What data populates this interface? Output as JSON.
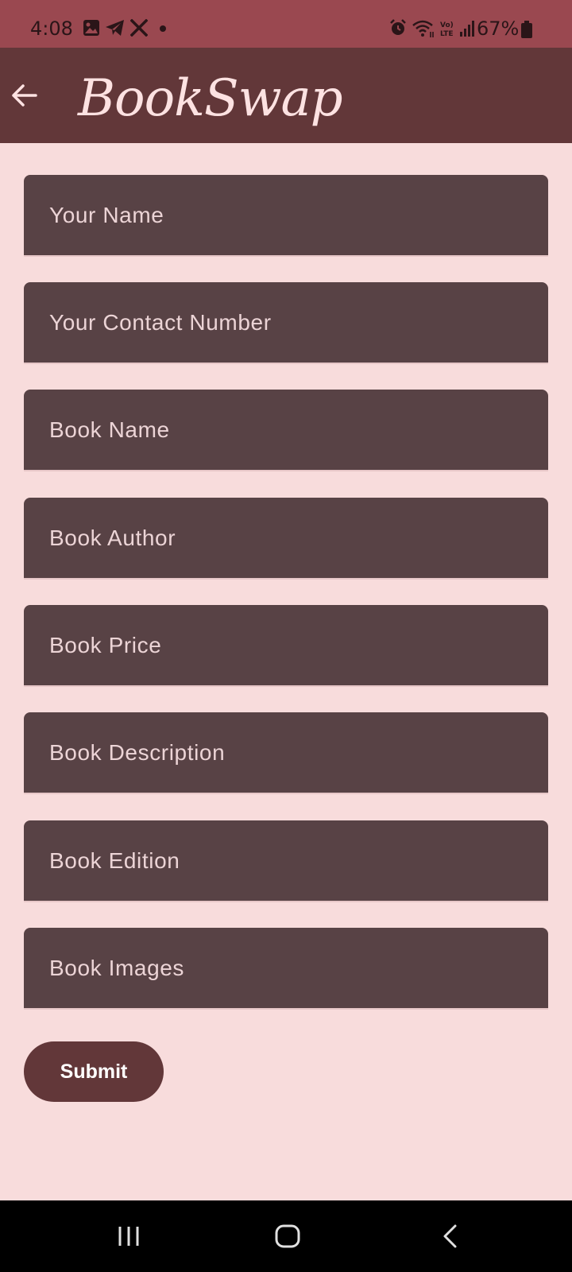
{
  "status_bar": {
    "time": "4:08",
    "battery_percent": "67%",
    "left_icons": [
      "gallery-icon",
      "telegram-icon",
      "x-icon",
      "dot-icon"
    ],
    "right_icons": [
      "alarm-icon",
      "wifi-icon",
      "volte-icon",
      "signal-icon",
      "battery-icon"
    ]
  },
  "app_bar": {
    "title": "BookSwap",
    "back_icon": "arrow-left-icon"
  },
  "form": {
    "fields": [
      {
        "placeholder": "Your Name",
        "value": ""
      },
      {
        "placeholder": "Your Contact Number",
        "value": ""
      },
      {
        "placeholder": "Book Name",
        "value": ""
      },
      {
        "placeholder": "Book Author",
        "value": ""
      },
      {
        "placeholder": "Book Price",
        "value": ""
      },
      {
        "placeholder": "Book Description",
        "value": ""
      },
      {
        "placeholder": "Book Edition",
        "value": ""
      },
      {
        "placeholder": "Book Images",
        "value": ""
      }
    ],
    "submit_label": "Submit"
  },
  "nav_bar": {
    "icons": [
      "recent-apps-icon",
      "home-icon",
      "back-icon"
    ]
  },
  "colors": {
    "status_bar_bg": "#9a4850",
    "app_bar_bg": "#623739",
    "page_bg": "#f8dcdc",
    "field_bg": "#584245",
    "field_text": "#ecd4d6",
    "submit_bg": "#623739"
  }
}
